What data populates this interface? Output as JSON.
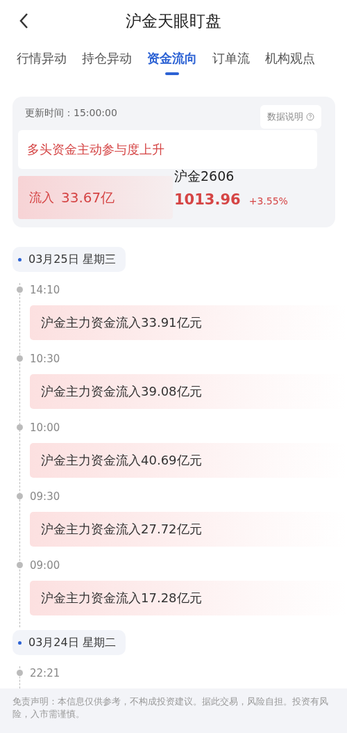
{
  "header": {
    "title": "沪金天眼盯盘"
  },
  "tabs": [
    {
      "label": "行情异动",
      "selected": false
    },
    {
      "label": "持仓异动",
      "selected": false
    },
    {
      "label": "资金流向",
      "selected": true
    },
    {
      "label": "订单流",
      "selected": false
    },
    {
      "label": "机构观点",
      "selected": false
    }
  ],
  "summary": {
    "update_time": "更新时间：15:00:00",
    "info_button": "数据说明",
    "headline": "多头资金主动参与度上升",
    "flow_label": "流入",
    "flow_value": "33.67亿",
    "contract": "沪金2606",
    "price": "1013.96",
    "change": "+3.55%"
  },
  "days": [
    {
      "date": "03月25日 星期三",
      "entries": [
        {
          "time": "14:10",
          "text": "沪金主力资金流入33.91亿元"
        },
        {
          "time": "10:30",
          "text": "沪金主力资金流入39.08亿元"
        },
        {
          "time": "10:00",
          "text": "沪金主力资金流入40.69亿元"
        },
        {
          "time": "09:30",
          "text": "沪金主力资金流入27.72亿元"
        },
        {
          "time": "09:00",
          "text": "沪金主力资金流入17.28亿元"
        }
      ]
    },
    {
      "date": "03月24日 星期二",
      "entries": [
        {
          "time": "22:21"
        }
      ]
    }
  ],
  "disclaimer": "免责声明：本信息仅供参考，不构成投资建议。据此交易，风险自担。投资有风险，入市需谨慎。"
}
